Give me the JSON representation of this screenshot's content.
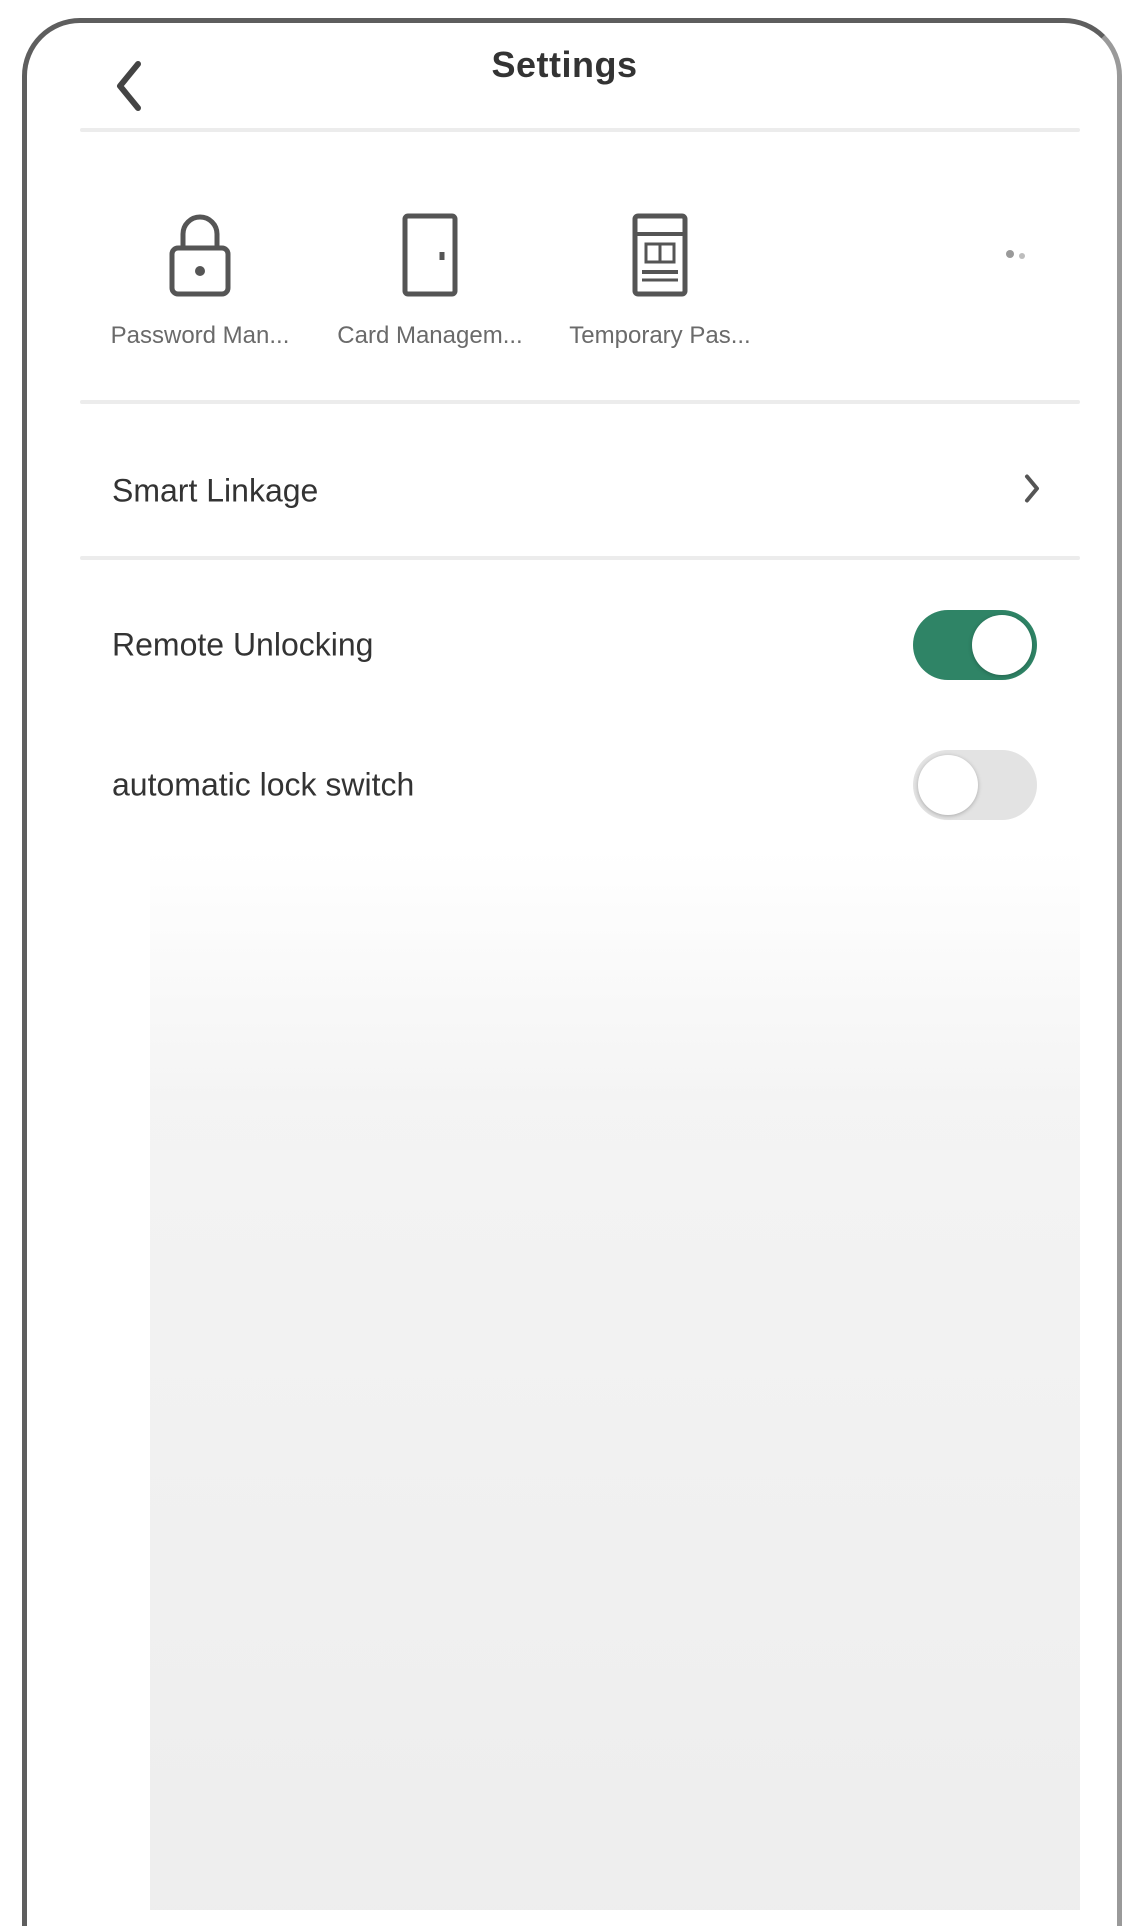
{
  "header": {
    "title": "Settings",
    "back_icon": "chevron-left-icon"
  },
  "quick_actions": [
    {
      "label": "Password Man...",
      "icon": "lock-icon"
    },
    {
      "label": "Card Managem...",
      "icon": "door-icon"
    },
    {
      "label": "Temporary Pas...",
      "icon": "calendar-icon"
    }
  ],
  "more_icon": "more-icon",
  "rows": {
    "smart_linkage": {
      "label": "Smart Linkage",
      "icon": "chevron-right-icon"
    },
    "remote_unlocking": {
      "label": "Remote Unlocking",
      "enabled": true
    },
    "automatic_lock": {
      "label": "automatic lock switch",
      "enabled": false
    }
  },
  "colors": {
    "toggle_on": "#2f8466",
    "toggle_off": "#e3e3e3",
    "divider": "#ececec"
  }
}
